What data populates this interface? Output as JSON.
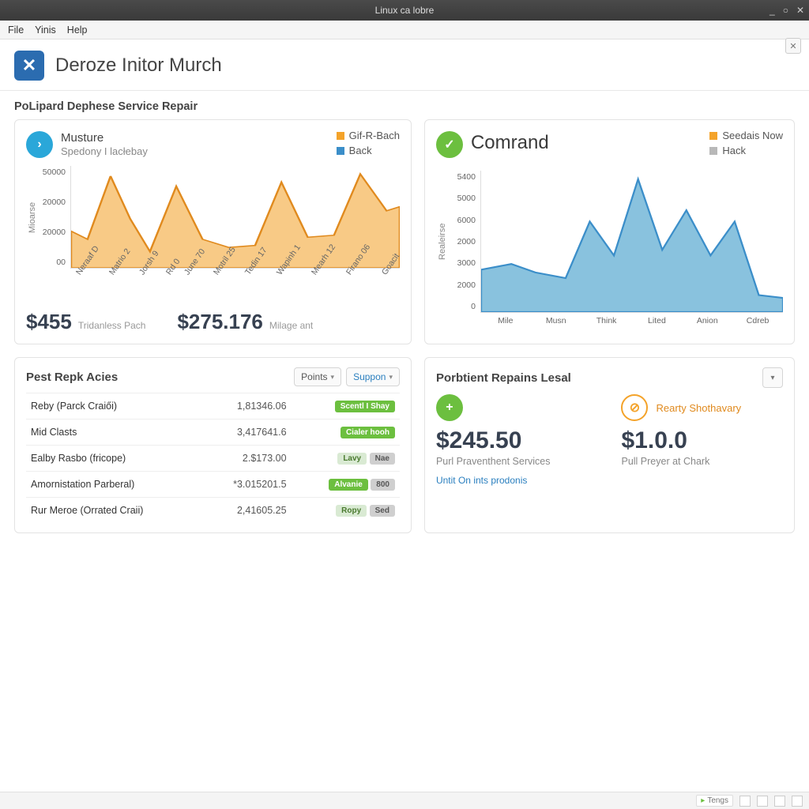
{
  "window": {
    "title": "Linux ca lobre",
    "controls": {
      "min": "_",
      "max": "○",
      "close": "✕"
    }
  },
  "menubar": {
    "file": "File",
    "yinis": "Yinis",
    "help": "Help"
  },
  "appheader": {
    "icon_glyph": "✕",
    "title": "Deroze Initor Murch"
  },
  "subtitle": "PoLipard Dephese Service Repair",
  "card_musture": {
    "title_line1": "Musture",
    "title_line2": "Spedony I lacłebay",
    "legend": [
      {
        "label": "Gif-R-Bach",
        "swatch": "sw-orange"
      },
      {
        "label": "Back",
        "swatch": "sw-blue"
      }
    ],
    "yaxis_label": "Mioarse",
    "metric1_val": "$455",
    "metric1_lbl": "Tridanless Pach",
    "metric2_val": "$275.176",
    "metric2_lbl": "Milage ant"
  },
  "card_comrand": {
    "title": "Comrand",
    "legend": [
      {
        "label": "Seedais Now",
        "swatch": "sw-orange"
      },
      {
        "label": "Hack",
        "swatch": "sw-grey"
      }
    ],
    "yaxis_label": "Realeirse"
  },
  "card_list": {
    "title": "Pest Repk Acies",
    "dd_points": "Points",
    "dd_support": "Suppon",
    "rows": [
      {
        "name": "Reby (Parck Craiői)",
        "value": "1,81346.06",
        "pill": "Scentl I Shay",
        "pill_cls": "pill"
      },
      {
        "name": "Mid Clasts",
        "value": "3,417641.6",
        "pill": "Cialer hooh",
        "pill_cls": "pill"
      },
      {
        "name": "Ealby Rasbo (fricope)",
        "value": "2.$173.00",
        "pill": "Lavy",
        "pill_cls": "pill pale",
        "pill2": "Nae",
        "pill2_cls": "pill grey"
      },
      {
        "name": "Amornistation Parberal)",
        "value": "*3.015201.5",
        "pill": "Alvanie",
        "pill_cls": "pill",
        "pill2": "800",
        "pill2_cls": "pill grey"
      },
      {
        "name": "Rur Meroe (Orrated Craii)",
        "value": "2,41605.25",
        "pill": "Ropy",
        "pill_cls": "pill pale",
        "pill2": "Sed",
        "pill2_cls": "pill grey"
      }
    ]
  },
  "card_summary": {
    "title": "Porbtient Repains Lesal",
    "col1": {
      "icon_glyph": "+",
      "value": "$245.50",
      "desc": "Purl Praventhent Services",
      "link": "Untit On ints prodonis"
    },
    "col2": {
      "icon_glyph": "⊘",
      "link_label": "Rearty Shothavary",
      "value": "$1.0.0",
      "desc": "Pull Preyer at Chark"
    }
  },
  "statusbar": {
    "chip1": "Tengs"
  },
  "chart_data": [
    {
      "type": "area",
      "title": "Musture / Spedony I lacłebay",
      "ylabel": "Mioarse",
      "ylim": [
        0,
        50000
      ],
      "yticks": [
        "50000",
        "20000",
        "20000",
        "00"
      ],
      "categories": [
        "Neraaf D",
        "Matrio 2",
        "Jorsh 9",
        "Rd 0",
        "June 70",
        "Motril 25",
        "Tedin 17",
        "Wapinh 1",
        "Mearh 12",
        "Firano 06",
        "Goacit"
      ],
      "series": [
        {
          "name": "Gif-R-Bach",
          "color": "#f4a32a",
          "values": [
            18000,
            14000,
            45000,
            24000,
            9000,
            40000,
            14000,
            11000,
            42000,
            15000,
            47000
          ]
        }
      ]
    },
    {
      "type": "area",
      "title": "Comrand",
      "ylabel": "Realeirse",
      "ylim": [
        0,
        5400
      ],
      "yticks": [
        "5400",
        "5000",
        "6000",
        "2000",
        "3000",
        "2000",
        "0"
      ],
      "categories": [
        "Mile",
        "Musn",
        "Think",
        "Lited",
        "Anion",
        "Cdreb"
      ],
      "series": [
        {
          "name": "Seedais Now",
          "color": "#3b8ec9",
          "values": [
            1800,
            1600,
            3800,
            5300,
            3000,
            3600
          ]
        }
      ]
    }
  ]
}
